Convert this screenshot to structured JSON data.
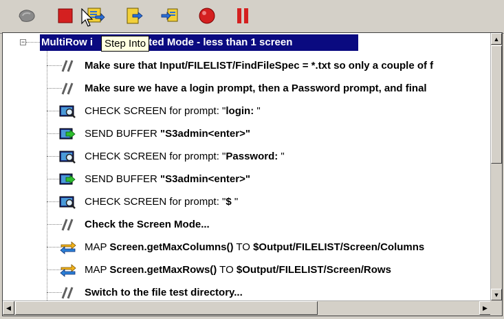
{
  "toolbar": {
    "buttons": [
      {
        "name": "run",
        "icon": "disabled-run-icon"
      },
      {
        "name": "stop",
        "icon": "stop-icon",
        "color": "#d42020"
      },
      {
        "name": "step-into",
        "icon": "step-into-icon"
      },
      {
        "name": "step-over",
        "icon": "step-over-icon"
      },
      {
        "name": "step-out",
        "icon": "step-out-icon"
      },
      {
        "name": "record",
        "icon": "record-icon",
        "color": "#d42020"
      },
      {
        "name": "pause",
        "icon": "pause-icon",
        "color": "#d42020"
      }
    ],
    "tooltip": "Step Into"
  },
  "tree": {
    "root_prefix": "MultiRow i",
    "root_suffix": "nted Mode - less than 1 screen",
    "rows": [
      {
        "type": "comment",
        "prefix": "",
        "bold": "Make sure that Input/FILELIST/FindFileSpec = *.txt so only a couple of f",
        "suffix": ""
      },
      {
        "type": "comment",
        "prefix": "",
        "bold": "Make sure we have a login prompt, then a Password prompt, and final",
        "suffix": ""
      },
      {
        "type": "check",
        "prefix": "CHECK SCREEN for prompt: \"",
        "bold": "login: ",
        "suffix": "\""
      },
      {
        "type": "send",
        "prefix": "SEND BUFFER ",
        "bold": "\"S3admin<enter>\"",
        "suffix": ""
      },
      {
        "type": "check",
        "prefix": "CHECK SCREEN for prompt: \"",
        "bold": "Password: ",
        "suffix": "\""
      },
      {
        "type": "send",
        "prefix": "SEND BUFFER ",
        "bold": "\"S3admin<enter>\"",
        "suffix": ""
      },
      {
        "type": "check",
        "prefix": "CHECK SCREEN for prompt: \"",
        "bold": "$ ",
        "suffix": "\""
      },
      {
        "type": "comment",
        "prefix": "",
        "bold": "Check the Screen Mode...",
        "suffix": ""
      },
      {
        "type": "map",
        "prefix": "MAP ",
        "bold": "Screen.getMaxColumns()",
        "mid": " TO ",
        "bold2": "$Output/FILELIST/Screen/Columns"
      },
      {
        "type": "map",
        "prefix": "MAP ",
        "bold": "Screen.getMaxRows()",
        "mid": " TO ",
        "bold2": "$Output/FILELIST/Screen/Rows"
      },
      {
        "type": "comment",
        "prefix": "",
        "bold": "Switch to the file test directory...",
        "suffix": ""
      }
    ]
  },
  "scroll": {
    "up": "▲",
    "down": "▼",
    "left": "◀",
    "right": "▶"
  }
}
